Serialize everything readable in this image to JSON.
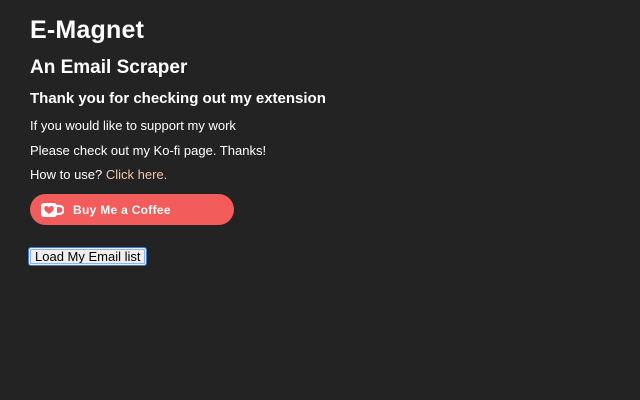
{
  "header": {
    "title": "E-Magnet",
    "subtitle": "An Email Scraper",
    "thanks": "Thank you for checking out my extension"
  },
  "support": {
    "line1": "If you would like to support my work",
    "line2": "Please check out my Ko-fi page. Thanks!",
    "howto_prefix": "How to use? ",
    "howto_link": "Click here."
  },
  "kofi": {
    "label": "Buy Me a Coffee",
    "icon": "kofi-cup-icon",
    "color": "#f25c5b"
  },
  "actions": {
    "load_label": "Load My Email list"
  },
  "colors": {
    "background": "#232323",
    "link": "#f4c6a6"
  }
}
